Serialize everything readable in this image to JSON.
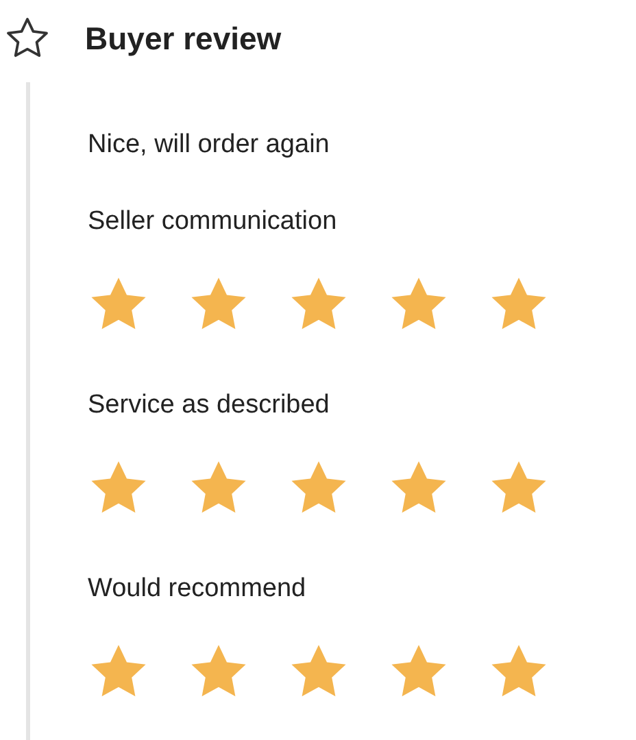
{
  "header": {
    "title": "Buyer review"
  },
  "comment": "Nice, will order again",
  "ratings": [
    {
      "label": "Seller communication",
      "stars": 5
    },
    {
      "label": "Service as described",
      "stars": 5
    },
    {
      "label": "Would recommend",
      "stars": 5
    }
  ]
}
